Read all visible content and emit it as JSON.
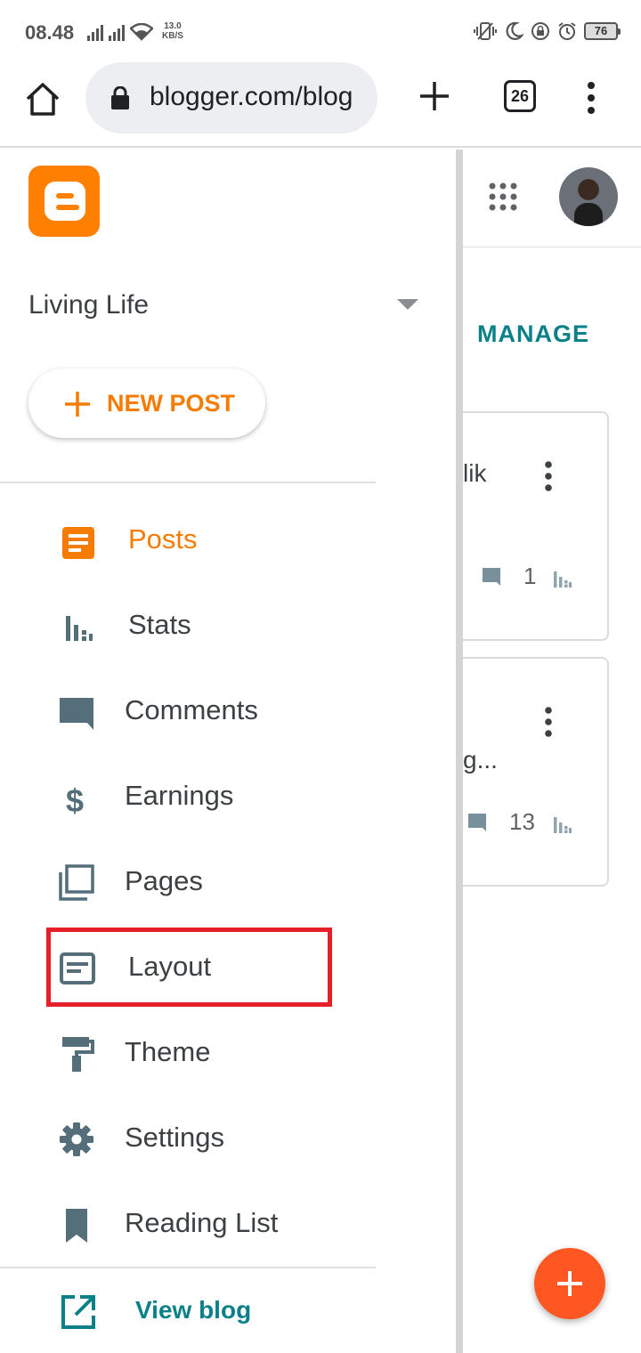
{
  "status_bar": {
    "time": "08.48",
    "net_speed": "13.0",
    "net_speed_unit": "KB/S",
    "battery": "76"
  },
  "browser": {
    "url": "blogger.com/blog",
    "tab_count": "26"
  },
  "drawer": {
    "blog_name": "Living Life",
    "new_post_label": "NEW POST",
    "nav_items": [
      {
        "label": "Posts",
        "icon": "posts-icon"
      },
      {
        "label": "Stats",
        "icon": "stats-icon"
      },
      {
        "label": "Comments",
        "icon": "comment-icon"
      },
      {
        "label": "Earnings",
        "icon": "dollar-icon"
      },
      {
        "label": "Pages",
        "icon": "pages-icon"
      },
      {
        "label": "Layout",
        "icon": "layout-icon"
      },
      {
        "label": "Theme",
        "icon": "paint-roller-icon"
      },
      {
        "label": "Settings",
        "icon": "gear-icon"
      },
      {
        "label": "Reading List",
        "icon": "bookmark-icon"
      }
    ],
    "view_blog_label": "View blog",
    "active_item": "Posts",
    "highlighted_item": "Layout"
  },
  "background": {
    "manage_label": "MANAGE",
    "posts": [
      {
        "title_fragment": "lik",
        "comment_count": "1"
      },
      {
        "title_fragment": "g...",
        "comment_count": "13"
      }
    ]
  },
  "colors": {
    "accent_orange": "#f57c00",
    "teal": "#0a8089",
    "highlight_red": "#e5202a",
    "fab_orange": "#ff5722",
    "icon_gray": "#546e7a"
  }
}
